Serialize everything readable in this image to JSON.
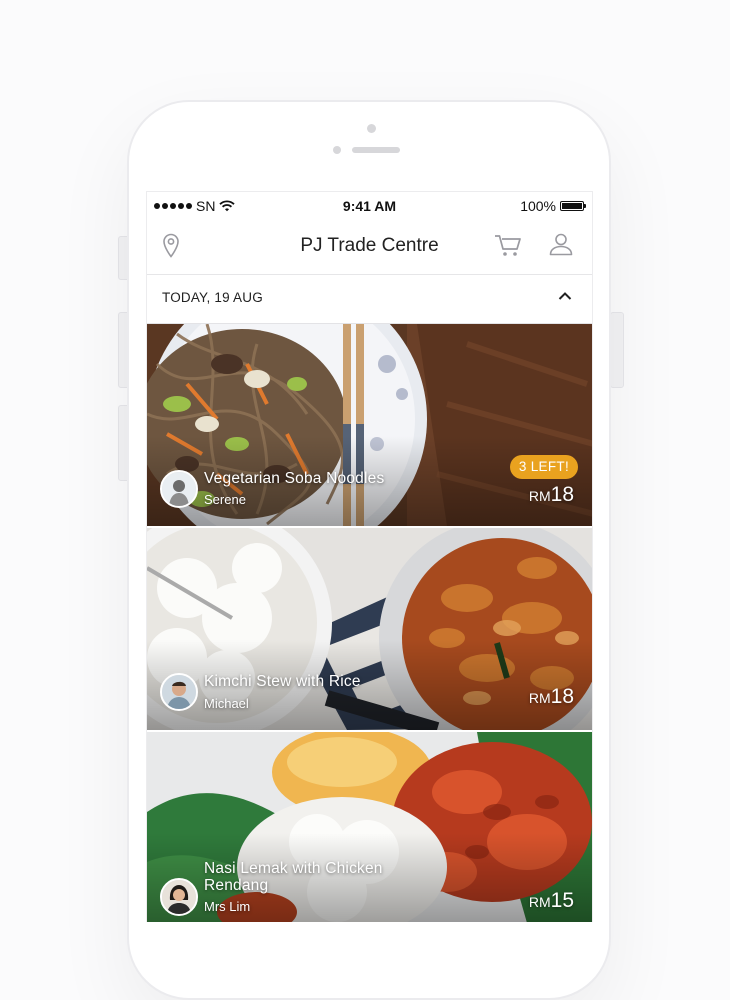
{
  "status_bar": {
    "carrier": "SN",
    "time": "9:41 AM",
    "battery": "100%"
  },
  "header": {
    "title": "PJ Trade Centre",
    "icons": [
      "location-pin-icon",
      "cart-icon",
      "profile-icon"
    ]
  },
  "date_bar": {
    "label": "TODAY, 19 AUG",
    "icon": "chevron-up-icon"
  },
  "listings": [
    {
      "name": "Vegetarian Soba Noodles",
      "cook": "Serene",
      "badge": "3 LEFT!",
      "currency": "RM",
      "price": "18"
    },
    {
      "name": "Kimchi Stew with Rice",
      "cook": "Michael",
      "currency": "RM",
      "price": "18"
    },
    {
      "name_line1": "Nasi Lemak with Chicken",
      "name_line2": "Rendang",
      "cook": "Mrs Lim",
      "currency": "RM",
      "price": "15"
    }
  ],
  "colors": {
    "badge": "#e9a21f",
    "text_dark": "#222222",
    "icon_gray": "#9a9aa0"
  }
}
